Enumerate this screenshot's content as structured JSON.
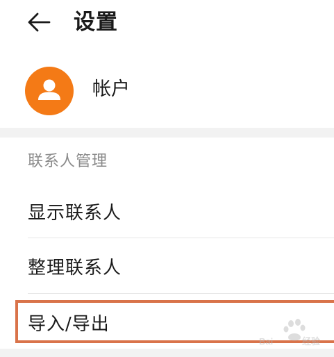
{
  "header": {
    "back_icon": "arrow-left-icon",
    "title": "设置"
  },
  "account": {
    "avatar_icon": "person-icon",
    "avatar_color": "#f47a16",
    "label": "帐户"
  },
  "contacts_section": {
    "title": "联系人管理",
    "items": [
      {
        "label": "显示联系人"
      },
      {
        "label": "整理联系人"
      },
      {
        "label": "导入/导出"
      }
    ]
  },
  "highlight_color": "#d9734a",
  "watermark": "Baidu 经验"
}
